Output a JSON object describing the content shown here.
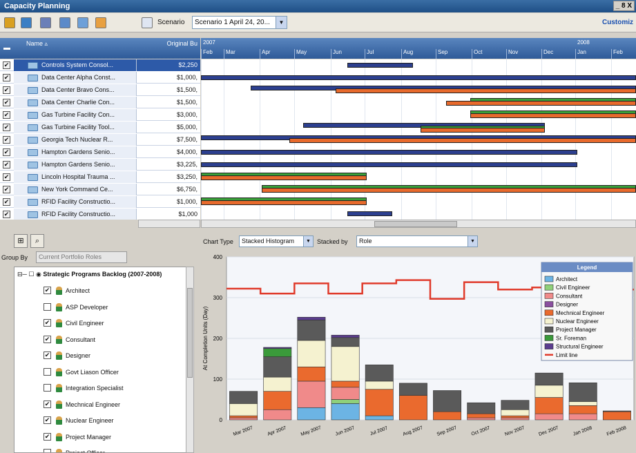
{
  "window": {
    "title": "Capacity Planning",
    "controls": "_ 8 X"
  },
  "toolbar": {
    "scenario_label": "Scenario",
    "scenario_value": "Scenario 1 April 24, 20...",
    "customize": "Customiz"
  },
  "grid": {
    "col_name": "Name",
    "col_original": "Original Bu",
    "rows": [
      {
        "name": "Controls System Consol...",
        "value": "$2,250",
        "selected": true
      },
      {
        "name": "Data Center Alpha Const...",
        "value": "$1,000,"
      },
      {
        "name": "Data Center Bravo Cons...",
        "value": "$1,500,"
      },
      {
        "name": "Data Center Charlie Con...",
        "value": "$1,500,"
      },
      {
        "name": "Gas Turbine Facility Con...",
        "value": "$3,000,"
      },
      {
        "name": "Gas Turbine Facility Tool...",
        "value": "$5,000,"
      },
      {
        "name": "Georgia Tech Nuclear R...",
        "value": "$7,500,"
      },
      {
        "name": "Hampton Gardens Senio...",
        "value": "$4,000,"
      },
      {
        "name": "Hampton Gardens Senio...",
        "value": "$3,225,"
      },
      {
        "name": "Lincoln Hospital Trauma ...",
        "value": "$3,250,"
      },
      {
        "name": "New York Command Ce...",
        "value": "$6,750,"
      },
      {
        "name": "RFID Facility Constructio...",
        "value": "$1,000,"
      },
      {
        "name": "RFID Facility Constructio...",
        "value": "$1,000"
      }
    ]
  },
  "gantt": {
    "years": [
      "2007",
      "2008"
    ],
    "months": [
      "Feb",
      "Mar",
      "Apr",
      "May",
      "Jun",
      "Jul",
      "Aug",
      "Sep",
      "Oct",
      "Nov",
      "Dec",
      "Jan",
      "Feb"
    ],
    "colors": {
      "blue": "#2c3f8f",
      "orange": "#e86a2c",
      "green": "#3aa03a"
    }
  },
  "left_panel": {
    "group_by_label": "Group By",
    "group_by_value": "Current Portfolio Roles",
    "root": "Strategic Programs Backlog (2007-2008)",
    "roles": [
      {
        "label": "Architect",
        "checked": true
      },
      {
        "label": "ASP Developer",
        "checked": false
      },
      {
        "label": "Civil Engineer",
        "checked": true
      },
      {
        "label": "Consultant",
        "checked": true
      },
      {
        "label": "Designer",
        "checked": true
      },
      {
        "label": "Govt Liason Officer",
        "checked": false
      },
      {
        "label": "Integration Specialist",
        "checked": false
      },
      {
        "label": "Mechnical Engineer",
        "checked": true
      },
      {
        "label": "Nuclear Engineer",
        "checked": true
      },
      {
        "label": "Project Manager",
        "checked": true
      },
      {
        "label": "Project Officer",
        "checked": false
      }
    ]
  },
  "chart_controls": {
    "chart_type_label": "Chart Type",
    "chart_type_value": "Stacked Histogram",
    "stacked_by_label": "Stacked by",
    "stacked_by_value": "Role"
  },
  "chart_data": {
    "type": "bar",
    "stacked": true,
    "ylabel": "At Completion Units (Day)",
    "ylim": [
      0,
      400
    ],
    "yticks": [
      0,
      100,
      200,
      300,
      400
    ],
    "categories": [
      "Mar 2007",
      "Apr 2007",
      "May 2007",
      "Jun 2007",
      "Jul 2007",
      "Aug 2007",
      "Sep 2007",
      "Oct 2007",
      "Nov 2007",
      "Dec 2007",
      "Jan 2008",
      "Feb 2008"
    ],
    "legend_title": "Legend",
    "legend_position": "top-right",
    "series": [
      {
        "name": "Architect",
        "color": "#6cb4e4",
        "values": [
          0,
          0,
          30,
          40,
          10,
          0,
          0,
          0,
          0,
          0,
          0,
          0
        ]
      },
      {
        "name": "Civil Engineer",
        "color": "#8fd07a",
        "values": [
          0,
          0,
          0,
          10,
          0,
          0,
          0,
          0,
          0,
          0,
          0,
          0
        ]
      },
      {
        "name": "Consultant",
        "color": "#f08a8a",
        "values": [
          5,
          25,
          65,
          30,
          0,
          0,
          0,
          5,
          5,
          15,
          15,
          0
        ]
      },
      {
        "name": "Designer",
        "color": "#8a4f9f",
        "values": [
          0,
          0,
          0,
          0,
          0,
          0,
          0,
          0,
          0,
          0,
          0,
          0
        ]
      },
      {
        "name": "Mechnical Engineer",
        "color": "#ea6a2e",
        "values": [
          5,
          45,
          35,
          15,
          65,
          60,
          20,
          10,
          5,
          40,
          20,
          20
        ]
      },
      {
        "name": "Nuclear Engineer",
        "color": "#f5f2d0",
        "values": [
          30,
          35,
          65,
          85,
          20,
          0,
          0,
          0,
          15,
          30,
          10,
          0
        ]
      },
      {
        "name": "Project Manager",
        "color": "#5a5a5a",
        "values": [
          30,
          50,
          50,
          22,
          40,
          30,
          52,
          27,
          23,
          30,
          46,
          2
        ]
      },
      {
        "name": "Sr. Foreman",
        "color": "#3a9a3a",
        "values": [
          0,
          20,
          0,
          0,
          0,
          0,
          0,
          0,
          0,
          0,
          0,
          0
        ]
      },
      {
        "name": "Structural Engineer",
        "color": "#5b3d8f",
        "values": [
          0,
          3,
          7,
          6,
          0,
          0,
          0,
          0,
          0,
          0,
          0,
          0
        ]
      }
    ],
    "limit_line": {
      "name": "Limit line",
      "color": "#e03a2a",
      "values": [
        322,
        310,
        335,
        310,
        335,
        343,
        297,
        338,
        320,
        325,
        335,
        320
      ]
    }
  }
}
